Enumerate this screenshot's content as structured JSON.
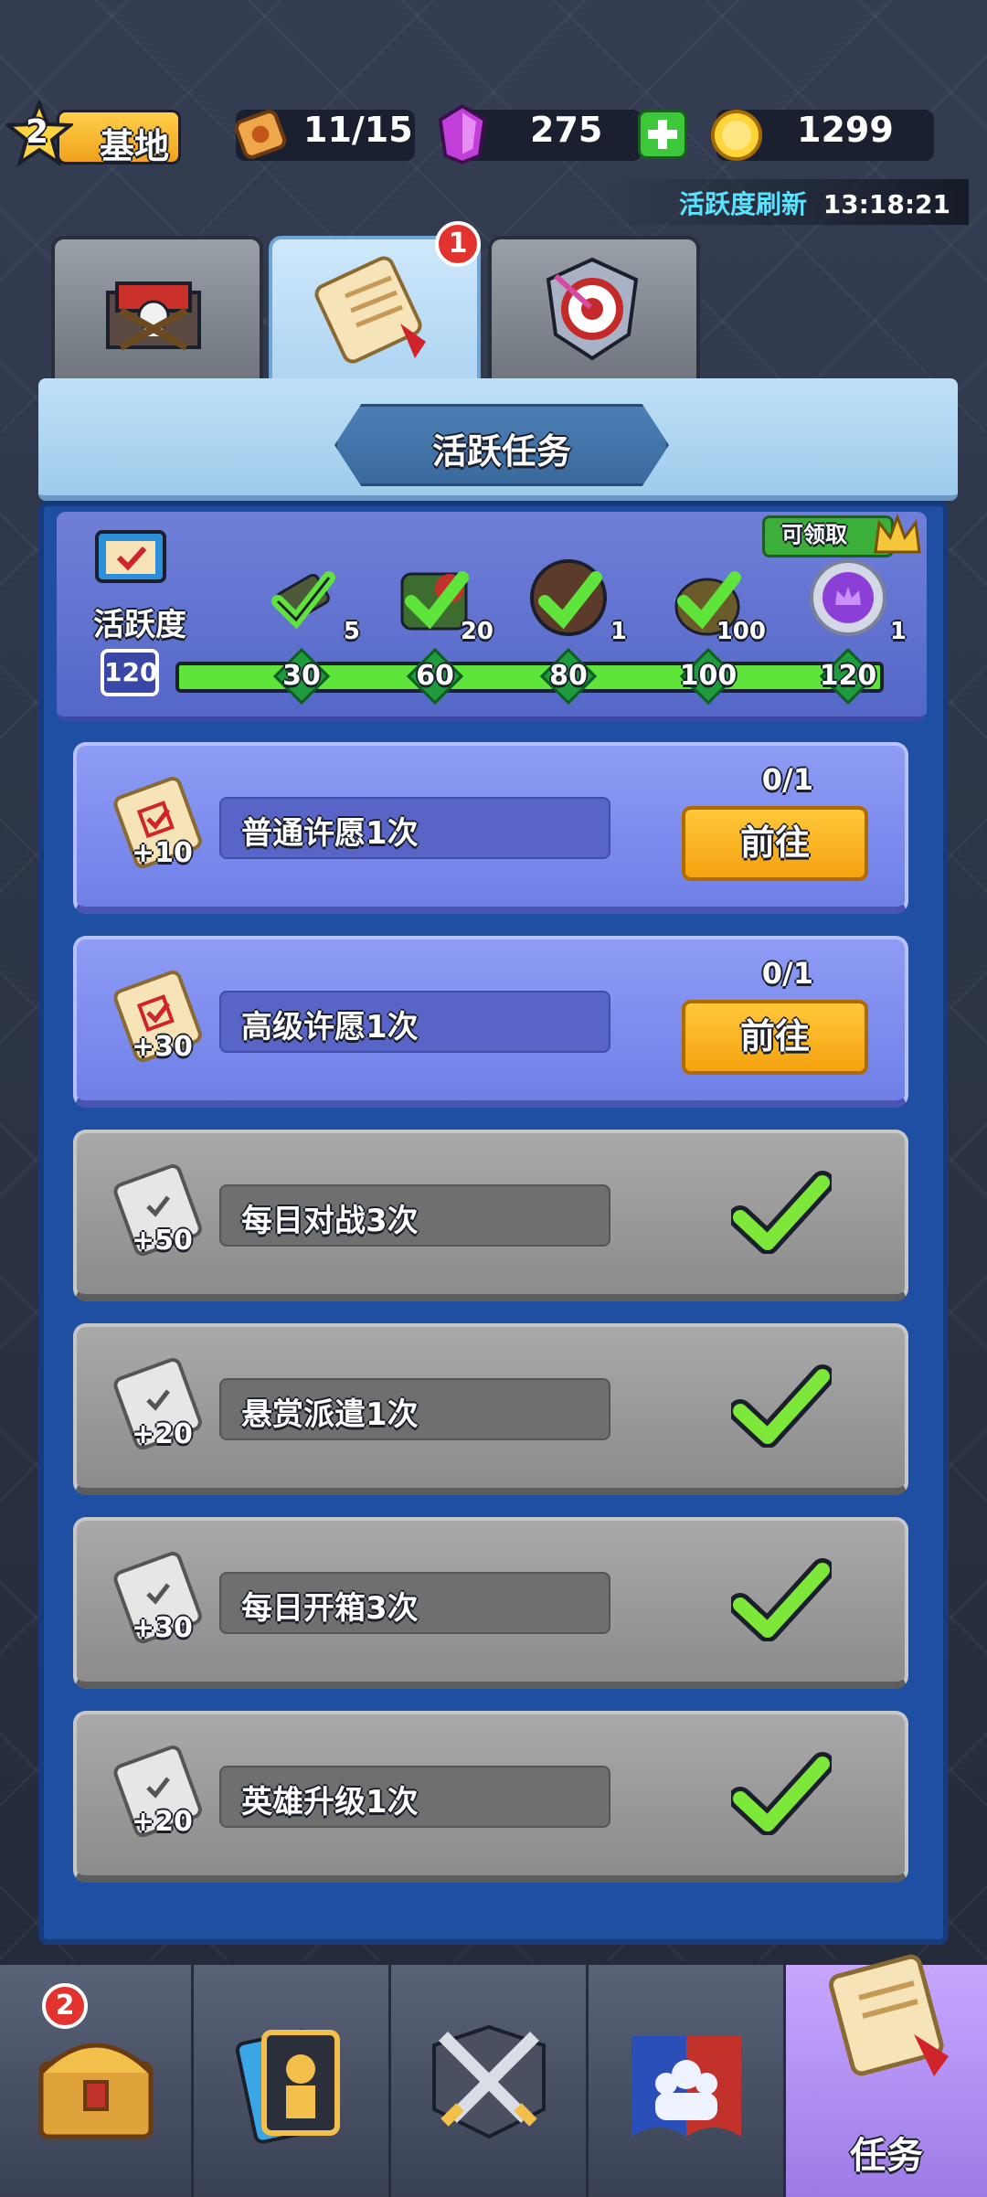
{
  "topbar": {
    "level": "2",
    "base_label": "基地",
    "tickets": "11/15",
    "gems": "275",
    "gold": "1299"
  },
  "refresh": {
    "label": "活跃度刷新",
    "time": "13:18:21"
  },
  "tabs": [
    {
      "icon": "castle-base-icon",
      "active": false
    },
    {
      "icon": "scroll-icon",
      "active": true,
      "badge": "1"
    },
    {
      "icon": "target-shield-icon",
      "active": false
    }
  ],
  "panel": {
    "title": "活跃任务"
  },
  "activity": {
    "label": "活跃度",
    "total": "120",
    "progress_fraction": 1.0,
    "claimable_label": "可领取",
    "milestones": [
      {
        "value": "30",
        "reward_count": "5",
        "claimed": true
      },
      {
        "value": "60",
        "reward_count": "20",
        "claimed": true
      },
      {
        "value": "80",
        "reward_count": "1",
        "claimed": true
      },
      {
        "value": "100",
        "reward_count": "100",
        "claimed": true
      },
      {
        "value": "120",
        "reward_count": "1",
        "claimed": false
      }
    ]
  },
  "tasks": [
    {
      "name": "普通许愿1次",
      "points": "+10",
      "progress": "0/1",
      "button": "前往",
      "done": false
    },
    {
      "name": "高级许愿1次",
      "points": "+30",
      "progress": "0/1",
      "button": "前往",
      "done": false
    },
    {
      "name": "每日对战3次",
      "points": "+50",
      "done": true
    },
    {
      "name": "悬赏派遣1次",
      "points": "+20",
      "done": true
    },
    {
      "name": "每日开箱3次",
      "points": "+30",
      "done": true
    },
    {
      "name": "英雄升级1次",
      "points": "+20",
      "done": true
    }
  ],
  "bottom_nav": {
    "chest_badge": "2",
    "tasks_label": "任务"
  },
  "colors": {
    "accent_green": "#5ee43a",
    "button_orange": "#f5a210",
    "refresh_cyan": "#59e3ff",
    "badge_red": "#e2332f"
  }
}
